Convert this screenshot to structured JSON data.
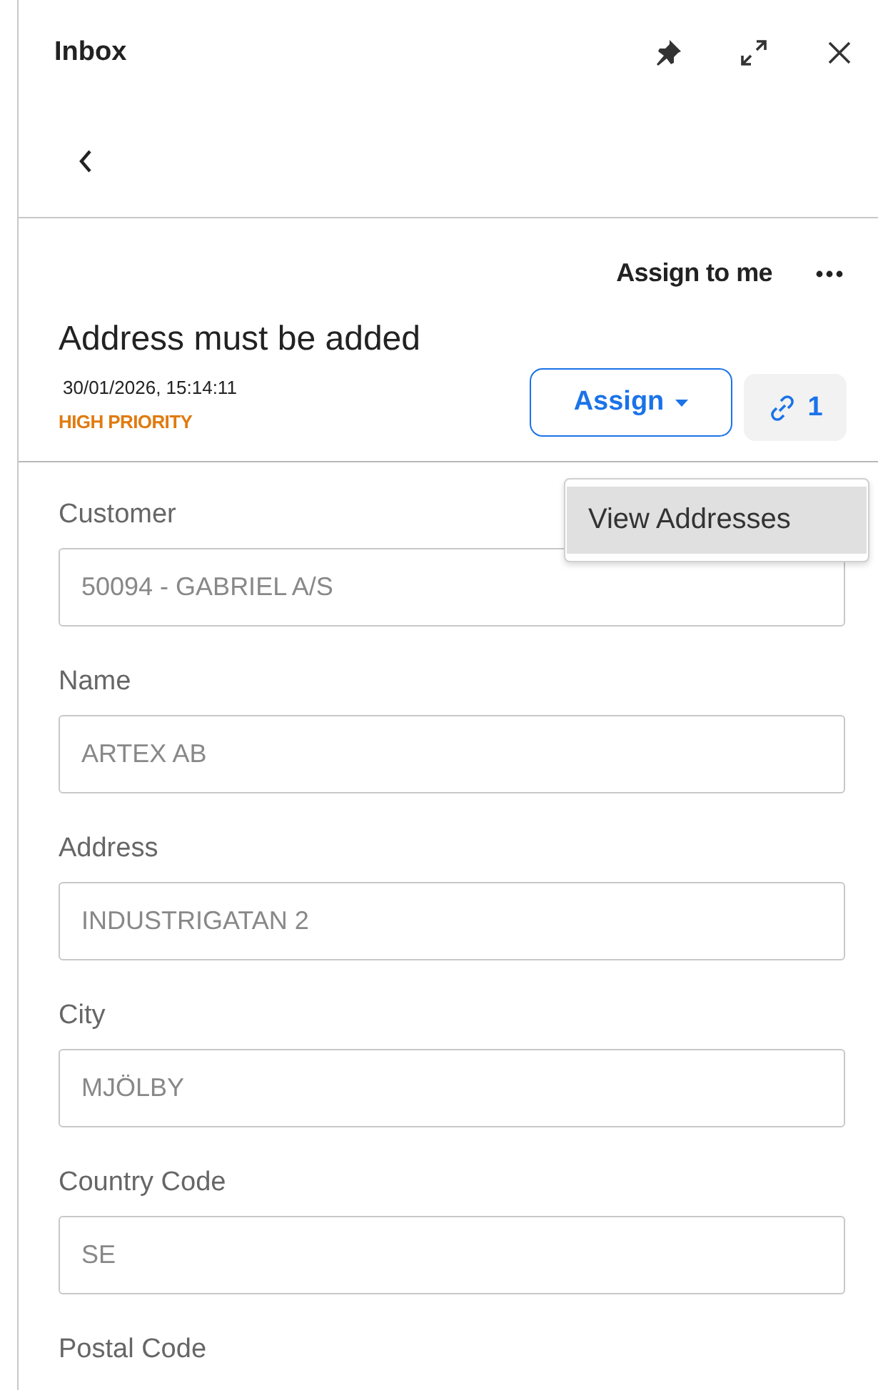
{
  "panel": {
    "title": "Inbox"
  },
  "header_actions": {
    "assign_to_me": "Assign to me"
  },
  "task": {
    "title": "Address must be added",
    "timestamp": "30/01/2026, 15:14:11",
    "priority": "HIGH PRIORITY",
    "assign_button": "Assign",
    "link_count": "1"
  },
  "menu": {
    "items": [
      {
        "label": "View Addresses",
        "selected": true
      }
    ]
  },
  "fields": [
    {
      "label": "Customer",
      "value": "50094 - GABRIEL A/S"
    },
    {
      "label": "Name",
      "value": "ARTEX AB"
    },
    {
      "label": "Address",
      "value": "INDUSTRIGATAN 2"
    },
    {
      "label": "City",
      "value": "MJÖLBY"
    },
    {
      "label": "Country Code",
      "value": "SE"
    },
    {
      "label": "Postal Code"
    }
  ]
}
